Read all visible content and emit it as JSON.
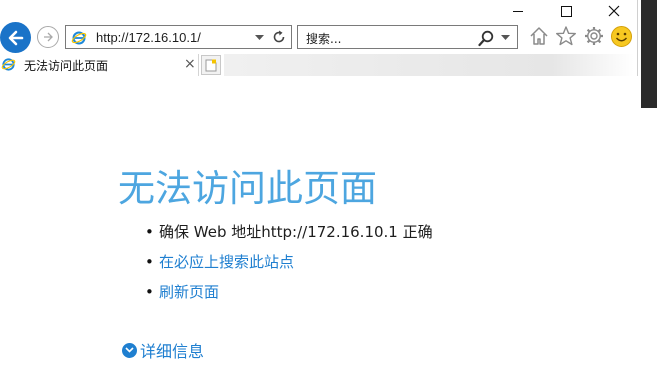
{
  "caption": {
    "minimize_icon": "minimize-icon",
    "maximize_icon": "maximize-icon",
    "close_icon": "close-icon"
  },
  "toolbar": {
    "address_value": "http://172.16.10.1/",
    "search_placeholder": "搜索...",
    "icons": [
      "back-icon",
      "forward-icon",
      "ie-icon",
      "dropdown-icon",
      "refresh-icon",
      "search-icon",
      "home-icon",
      "star-icon",
      "gear-icon",
      "smiley-icon"
    ]
  },
  "tabs": [
    {
      "title": "无法访问此页面",
      "close": "×",
      "active": true
    }
  ],
  "page": {
    "title": "无法访问此页面",
    "bullets": [
      {
        "text": "确保 Web 地址http://172.16.10.1 正确",
        "link": false
      },
      {
        "text": "在必应上搜索此站点",
        "link": true
      },
      {
        "text": "刷新页面",
        "link": true
      }
    ],
    "more_info": "详细信息",
    "bullet_glyph": "•"
  },
  "colors": {
    "accent": "#1a73c8",
    "title": "#4da6e0",
    "link": "#1f7fd0"
  }
}
